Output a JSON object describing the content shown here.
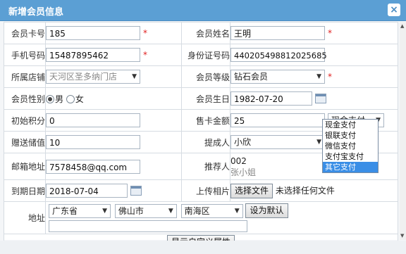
{
  "dialog": {
    "title": "新增会员信息",
    "close_glyph": "×"
  },
  "labels": {
    "card_no": "会员卡号",
    "name": "会员姓名",
    "phone": "手机号码",
    "id_no": "身份证号码",
    "store": "所属店铺",
    "level": "会员等级",
    "gender": "会员性别",
    "birthday": "会员生日",
    "points": "初始积分",
    "card_amount": "售卡金额",
    "gift_value": "赠送储值",
    "referrer_by": "提成人",
    "email": "邮箱地址",
    "recommender": "推荐人",
    "expire": "到期日期",
    "photo": "上传相片",
    "address": "地址"
  },
  "values": {
    "card_no": "185",
    "name": "王明",
    "phone": "15487895462",
    "id_no": "440205498812025685",
    "store": "天河区圣多纳门店",
    "level": "钻石会员",
    "gender_male": "男",
    "gender_female": "女",
    "birthday": "1982-07-20",
    "points": "0",
    "card_amount": "25",
    "payment": "现金支付",
    "gift_value": "10",
    "commission_person": "小欣",
    "email": "7578458@qq.com",
    "recommender_id": "002",
    "recommender_name": "张小姐",
    "expire": "2018-07-04",
    "photo_button": "选择文件",
    "photo_status": "未选择任何文件",
    "province": "广东省",
    "city": "佛山市",
    "district": "南海区",
    "set_default": "设为默认",
    "address_detail": "",
    "show_custom": "显示自定义属性"
  },
  "required_mark": "*",
  "payment_options": [
    "现金支付",
    "银联支付",
    "微信支付",
    "支付宝支付",
    "其它支付"
  ],
  "payment_highlighted": "其它支付",
  "colors": {
    "titlebar": "#5b9fd4",
    "required": "#e02020",
    "highlight": "#3a8ee6"
  }
}
